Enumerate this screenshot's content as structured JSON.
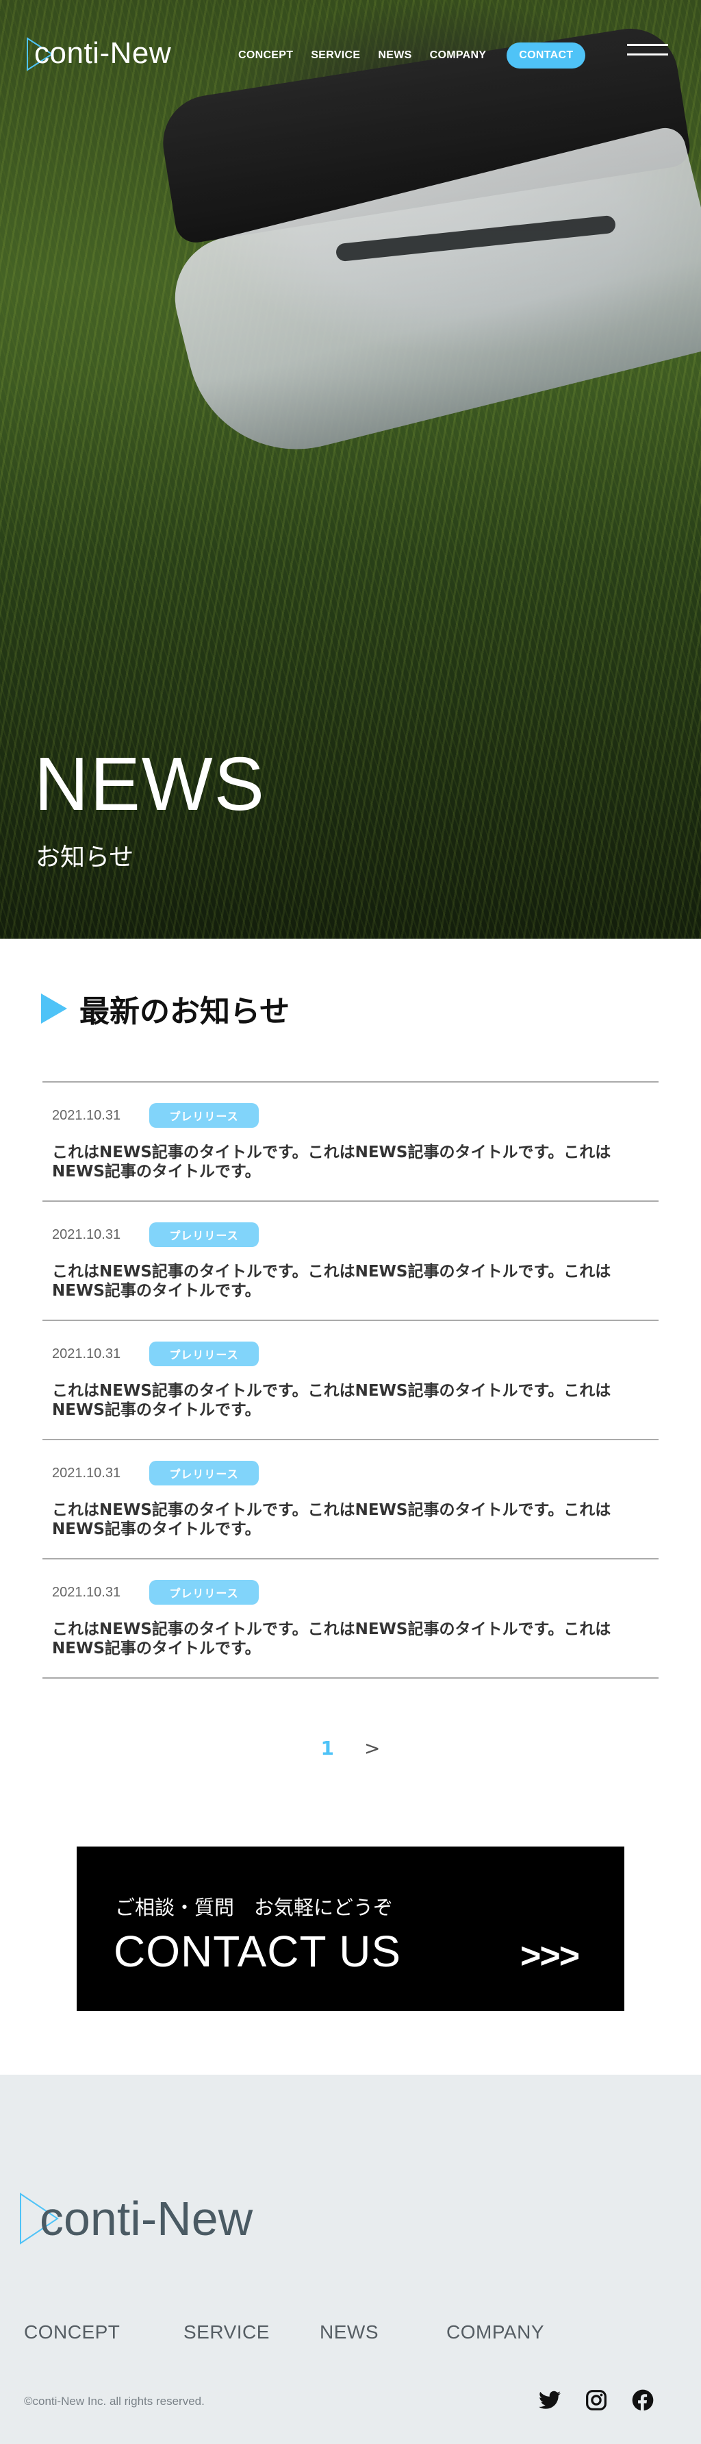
{
  "header": {
    "logo_text": "conti-New",
    "nav": [
      "CONCEPT",
      "SERVICE",
      "NEWS",
      "COMPANY"
    ],
    "contact_label": "CONTACT",
    "menu_icon": "hamburger-menu-icon"
  },
  "hero": {
    "title": "NEWS",
    "subtitle": "お知らせ"
  },
  "news": {
    "heading": "最新のお知らせ",
    "items": [
      {
        "date": "2021.10.31",
        "tag": "プレリリース",
        "title": "これはNEWS記事のタイトルです。これはNEWS記事のタイトルです。これはNEWS記事のタイトルです。"
      },
      {
        "date": "2021.10.31",
        "tag": "プレリリース",
        "title": "これはNEWS記事のタイトルです。これはNEWS記事のタイトルです。これはNEWS記事のタイトルです。"
      },
      {
        "date": "2021.10.31",
        "tag": "プレリリース",
        "title": "これはNEWS記事のタイトルです。これはNEWS記事のタイトルです。これはNEWS記事のタイトルです。"
      },
      {
        "date": "2021.10.31",
        "tag": "プレリリース",
        "title": "これはNEWS記事のタイトルです。これはNEWS記事のタイトルです。これはNEWS記事のタイトルです。"
      },
      {
        "date": "2021.10.31",
        "tag": "プレリリース",
        "title": "これはNEWS記事のタイトルです。これはNEWS記事のタイトルです。これはNEWS記事のタイトルです。"
      }
    ]
  },
  "pagination": {
    "current": "1",
    "next": ">"
  },
  "contact": {
    "sub": "ご相談・質問　お気軽にどうぞ",
    "title": "CONTACT US",
    "arrow": ">>>"
  },
  "footer": {
    "logo_text": "conti-New",
    "nav": [
      "CONCEPT",
      "SERVICE",
      "NEWS",
      "COMPANY"
    ],
    "copyright": "©conti-New Inc. all rights reserved.",
    "social": [
      "twitter-icon",
      "instagram-icon",
      "facebook-icon"
    ]
  },
  "colors": {
    "accent": "#4fc3f7",
    "tag": "#81d4fa",
    "footer_bg": "#e8ecee",
    "contact_bg": "#000000"
  }
}
